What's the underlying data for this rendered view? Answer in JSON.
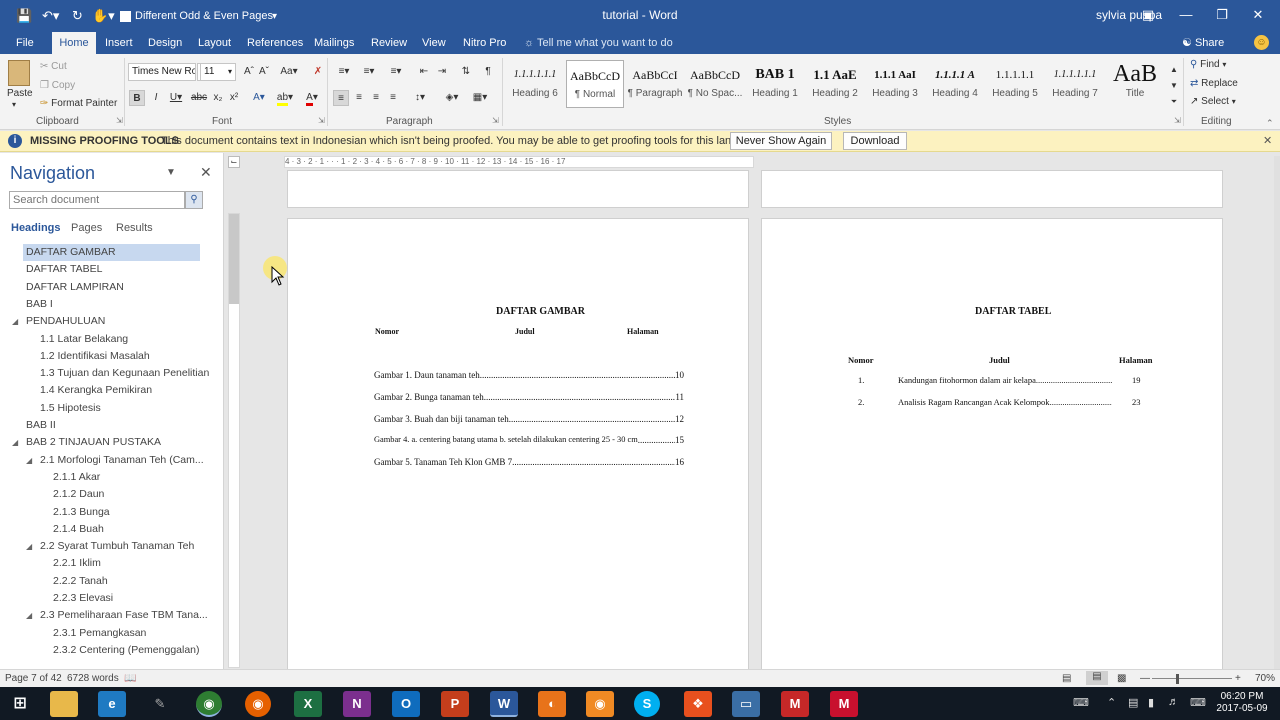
{
  "titlebar": {
    "save_icon": "save-icon",
    "undo_icon": "undo-icon",
    "redo_icon": "redo-icon",
    "touch_icon": "touch-mode-icon",
    "checkbox_label": "Different Odd & Even Pages",
    "doc_title": "tutorial - Word",
    "user": "sylvia puspa"
  },
  "tabs": [
    "File",
    "Home",
    "Insert",
    "Design",
    "Layout",
    "References",
    "Mailings",
    "Review",
    "View",
    "Nitro Pro"
  ],
  "tell_me": "Tell me what you want to do",
  "share": "Share",
  "clipboard": {
    "paste": "Paste",
    "cut": "Cut",
    "copy": "Copy",
    "format_painter": "Format Painter",
    "label": "Clipboard"
  },
  "font": {
    "name": "Times New Ro",
    "size": "11",
    "label": "Font"
  },
  "paragraph": {
    "label": "Paragraph"
  },
  "styles": {
    "label": "Styles",
    "items": [
      {
        "preview": "1.1.1.1.1.1",
        "name": "Heading 6"
      },
      {
        "preview": "AaBbCcD",
        "name": "¶ Normal"
      },
      {
        "preview": "AaBbCcI",
        "name": "¶ Paragraph"
      },
      {
        "preview": "AaBbCcD",
        "name": "¶ No Spac..."
      },
      {
        "preview": "BAB 1",
        "name": "Heading 1"
      },
      {
        "preview": "1.1 AaE",
        "name": "Heading 2"
      },
      {
        "preview": "1.1.1 AaI",
        "name": "Heading 3"
      },
      {
        "preview": "1.1.1.1 A",
        "name": "Heading 4"
      },
      {
        "preview": "1.1.1.1.1",
        "name": "Heading 5"
      },
      {
        "preview": "1.1.1.1.1.1",
        "name": "Heading 7"
      },
      {
        "preview": "AaB",
        "name": "Title"
      }
    ]
  },
  "editing": {
    "find": "Find",
    "replace": "Replace",
    "select": "Select",
    "label": "Editing"
  },
  "message_bar": {
    "title": "MISSING PROOFING TOOLS",
    "text": "This document contains text in Indonesian which isn't being proofed. You may be able to get proofing tools for this language.",
    "never_show": "Never Show Again",
    "download": "Download"
  },
  "navigation": {
    "title": "Navigation",
    "search_placeholder": "Search document",
    "tabs": [
      "Headings",
      "Pages",
      "Results"
    ],
    "items": [
      {
        "label": "DAFTAR GAMBAR",
        "level": 0,
        "selected": true,
        "expand": ""
      },
      {
        "label": "DAFTAR TABEL",
        "level": 0,
        "expand": ""
      },
      {
        "label": "DAFTAR LAMPIRAN",
        "level": 0,
        "expand": ""
      },
      {
        "label": "BAB I",
        "level": 0,
        "expand": ""
      },
      {
        "label": "PENDAHULUAN",
        "level": 0,
        "expand": "open"
      },
      {
        "label": "1.1 Latar Belakang",
        "level": 1,
        "expand": ""
      },
      {
        "label": "1.2 Identifikasi Masalah",
        "level": 1,
        "expand": ""
      },
      {
        "label": "1.3 Tujuan dan Kegunaan Penelitian",
        "level": 1,
        "expand": ""
      },
      {
        "label": "1.4 Kerangka Pemikiran",
        "level": 1,
        "expand": ""
      },
      {
        "label": "1.5 Hipotesis",
        "level": 1,
        "expand": ""
      },
      {
        "label": "BAB II",
        "level": 0,
        "expand": ""
      },
      {
        "label": "BAB 2 TINJAUAN PUSTAKA",
        "level": 0,
        "expand": "open"
      },
      {
        "label": "2.1 Morfologi Tanaman Teh (Cam...",
        "level": 1,
        "expand": "open"
      },
      {
        "label": "2.1.1 Akar",
        "level": 2,
        "expand": ""
      },
      {
        "label": "2.1.2 Daun",
        "level": 2,
        "expand": ""
      },
      {
        "label": "2.1.3 Bunga",
        "level": 2,
        "expand": ""
      },
      {
        "label": "2.1.4  Buah",
        "level": 2,
        "expand": ""
      },
      {
        "label": "2.2 Syarat Tumbuh Tanaman Teh",
        "level": 1,
        "expand": "open"
      },
      {
        "label": "2.2.1  Iklim",
        "level": 2,
        "expand": ""
      },
      {
        "label": "2.2.2 Tanah",
        "level": 2,
        "expand": ""
      },
      {
        "label": "2.2.3 Elevasi",
        "level": 2,
        "expand": ""
      },
      {
        "label": "2.3 Pemeliharaan Fase TBM Tana...",
        "level": 1,
        "expand": "open"
      },
      {
        "label": "2.3.1 Pemangkasan",
        "level": 2,
        "expand": ""
      },
      {
        "label": "2.3.2 Centering (Pemenggalan)",
        "level": 2,
        "expand": ""
      }
    ]
  },
  "ruler_text": "4 · 3 · 2 · 1 · · · 1 · 2 · 3 · 4 · 5 · 6 · 7 · 8 · 9 · 10 · 11 · 12 · 13 · 14 · 15 · 16 · 17",
  "page_left": {
    "heading": "DAFTAR GAMBAR",
    "col_nomor": "Nomor",
    "col_judul": "Judul",
    "col_halaman": "Halaman",
    "entries": [
      {
        "text": "Gambar 1. Daun tanaman teh",
        "page": "10"
      },
      {
        "text": "Gambar 2. Bunga tanaman teh. ",
        "page": "11"
      },
      {
        "text": "Gambar 3. Buah dan biji tanaman teh. ",
        "page": "12"
      },
      {
        "text": "Gambar 4. a. centering batang utama b. setelah dilakukan centering 25 - 30 cm",
        "page": "15"
      },
      {
        "text": "Gambar 5. Tanaman Teh Klon GMB 7",
        "page": "16"
      }
    ]
  },
  "page_right": {
    "heading": "DAFTAR TABEL",
    "col_nomor": "Nomor",
    "col_judul": "Judul",
    "col_halaman": "Halaman",
    "rows": [
      {
        "no": "1.",
        "title": "Kandungan fitohormon dalam air kelapa ",
        "page": "19"
      },
      {
        "no": "2.",
        "title": "Analisis Ragam Rancangan Acak Kelompok ",
        "page": "23"
      }
    ]
  },
  "status": {
    "page": "Page 7 of 42",
    "words": "6728 words",
    "zoom": "70%"
  },
  "taskbar": {
    "time": "06:20 PM",
    "date": "2017-05-09"
  }
}
